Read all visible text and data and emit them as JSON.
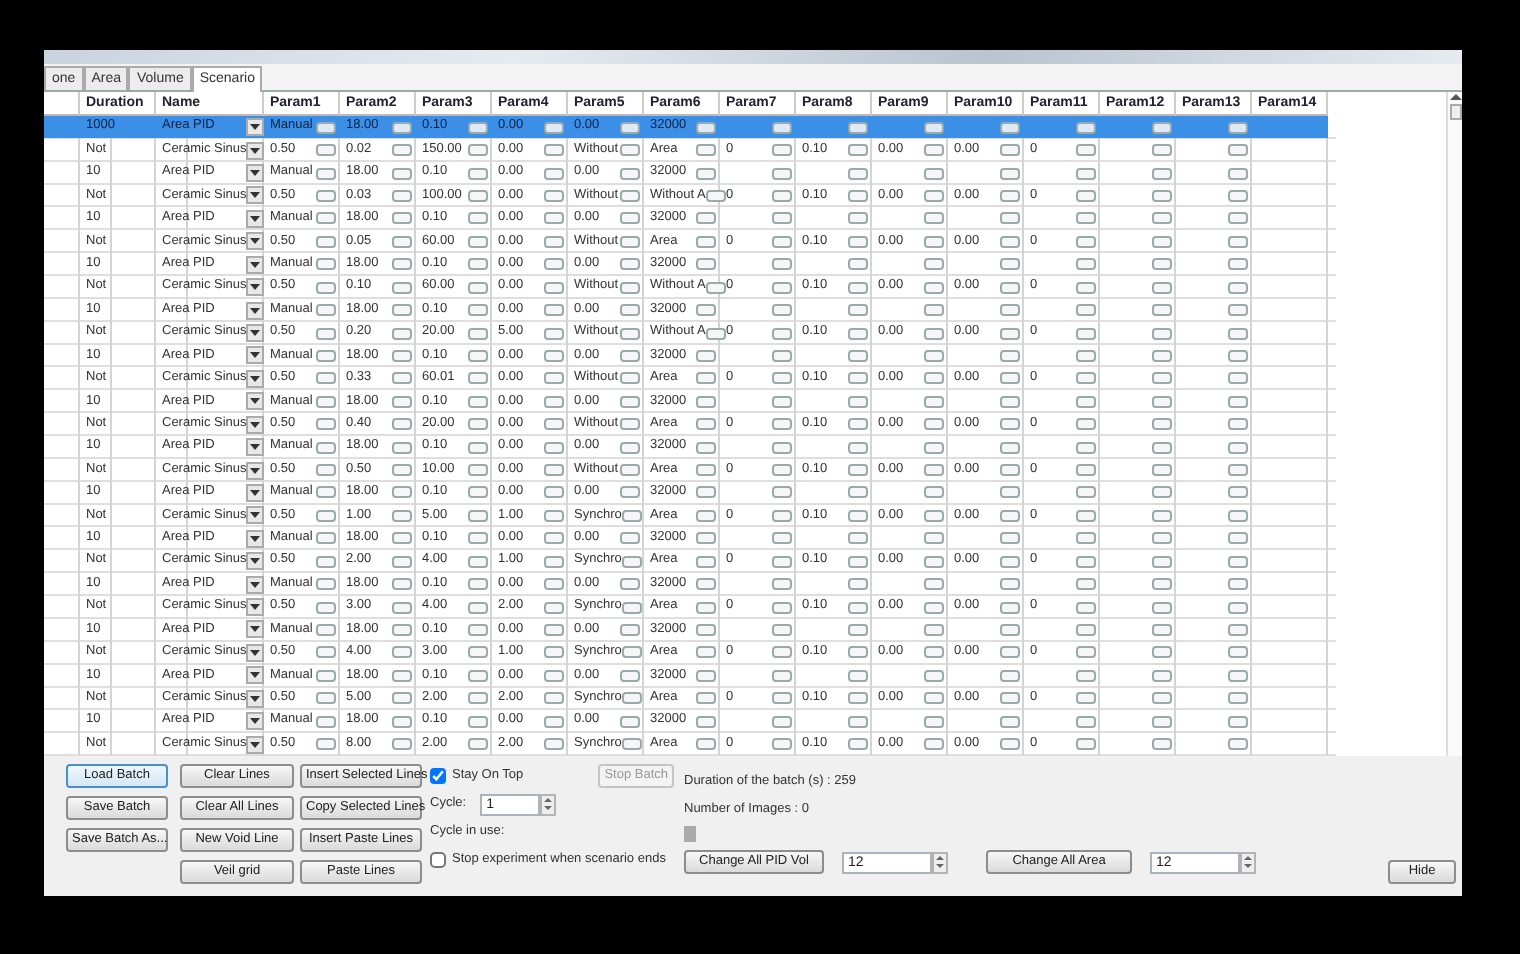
{
  "tabs": [
    {
      "label": "one",
      "selected": false
    },
    {
      "label": "Area",
      "selected": false
    },
    {
      "label": "Volume",
      "selected": false
    },
    {
      "label": "Scenario",
      "selected": true
    }
  ],
  "table": {
    "columns": [
      "Duration",
      "Name",
      "Param1",
      "Param2",
      "Param3",
      "Param4",
      "Param5",
      "Param6",
      "Param7",
      "Param8",
      "Param9",
      "Param10",
      "Param11",
      "Param12",
      "Param13",
      "Param14"
    ],
    "rows": [
      {
        "selected": true,
        "duration": "1000",
        "name": "Area PID",
        "params": [
          "Manual",
          "18.00",
          "0.10",
          "0.00",
          "0.00",
          "32000"
        ]
      },
      {
        "selected": false,
        "duration": "Not",
        "name": "Ceramic Sinus",
        "params": [
          "0.50",
          "0.02",
          "150.00",
          "0.00",
          "Without",
          "Area",
          "0",
          "0.10",
          "0.00",
          "0.00",
          "0"
        ]
      },
      {
        "selected": false,
        "duration": "10",
        "name": "Area PID",
        "params": [
          "Manual",
          "18.00",
          "0.10",
          "0.00",
          "0.00",
          "32000"
        ]
      },
      {
        "selected": false,
        "duration": "Not",
        "name": "Ceramic Sinus",
        "params": [
          "0.50",
          "0.03",
          "100.00",
          "0.00",
          "Without",
          "Without A",
          "0",
          "0.10",
          "0.00",
          "0.00",
          "0"
        ]
      },
      {
        "selected": false,
        "duration": "10",
        "name": "Area PID",
        "params": [
          "Manual",
          "18.00",
          "0.10",
          "0.00",
          "0.00",
          "32000"
        ]
      },
      {
        "selected": false,
        "duration": "Not",
        "name": "Ceramic Sinus",
        "params": [
          "0.50",
          "0.05",
          "60.00",
          "0.00",
          "Without",
          "Area",
          "0",
          "0.10",
          "0.00",
          "0.00",
          "0"
        ]
      },
      {
        "selected": false,
        "duration": "10",
        "name": "Area PID",
        "params": [
          "Manual",
          "18.00",
          "0.10",
          "0.00",
          "0.00",
          "32000"
        ]
      },
      {
        "selected": false,
        "duration": "Not",
        "name": "Ceramic Sinus",
        "params": [
          "0.50",
          "0.10",
          "60.00",
          "0.00",
          "Without",
          "Without A",
          "0",
          "0.10",
          "0.00",
          "0.00",
          "0"
        ]
      },
      {
        "selected": false,
        "duration": "10",
        "name": "Area PID",
        "params": [
          "Manual",
          "18.00",
          "0.10",
          "0.00",
          "0.00",
          "32000"
        ]
      },
      {
        "selected": false,
        "duration": "Not",
        "name": "Ceramic Sinus",
        "params": [
          "0.50",
          "0.20",
          "20.00",
          "5.00",
          "Without",
          "Without A",
          "0",
          "0.10",
          "0.00",
          "0.00",
          "0"
        ]
      },
      {
        "selected": false,
        "duration": "10",
        "name": "Area PID",
        "params": [
          "Manual",
          "18.00",
          "0.10",
          "0.00",
          "0.00",
          "32000"
        ]
      },
      {
        "selected": false,
        "duration": "Not",
        "name": "Ceramic Sinus",
        "params": [
          "0.50",
          "0.33",
          "60.01",
          "0.00",
          "Without",
          "Area",
          "0",
          "0.10",
          "0.00",
          "0.00",
          "0"
        ]
      },
      {
        "selected": false,
        "duration": "10",
        "name": "Area PID",
        "params": [
          "Manual",
          "18.00",
          "0.10",
          "0.00",
          "0.00",
          "32000"
        ]
      },
      {
        "selected": false,
        "duration": "Not",
        "name": "Ceramic Sinus",
        "params": [
          "0.50",
          "0.40",
          "20.00",
          "0.00",
          "Without",
          "Area",
          "0",
          "0.10",
          "0.00",
          "0.00",
          "0"
        ]
      },
      {
        "selected": false,
        "duration": "10",
        "name": "Area PID",
        "params": [
          "Manual",
          "18.00",
          "0.10",
          "0.00",
          "0.00",
          "32000"
        ]
      },
      {
        "selected": false,
        "duration": "Not",
        "name": "Ceramic Sinus",
        "params": [
          "0.50",
          "0.50",
          "10.00",
          "0.00",
          "Without",
          "Area",
          "0",
          "0.10",
          "0.00",
          "0.00",
          "0"
        ]
      },
      {
        "selected": false,
        "duration": "10",
        "name": "Area PID",
        "params": [
          "Manual",
          "18.00",
          "0.10",
          "0.00",
          "0.00",
          "32000"
        ]
      },
      {
        "selected": false,
        "duration": "Not",
        "name": "Ceramic Sinus",
        "params": [
          "0.50",
          "1.00",
          "5.00",
          "1.00",
          "Synchro",
          "Area",
          "0",
          "0.10",
          "0.00",
          "0.00",
          "0"
        ]
      },
      {
        "selected": false,
        "duration": "10",
        "name": "Area PID",
        "params": [
          "Manual",
          "18.00",
          "0.10",
          "0.00",
          "0.00",
          "32000"
        ]
      },
      {
        "selected": false,
        "duration": "Not",
        "name": "Ceramic Sinus",
        "params": [
          "0.50",
          "2.00",
          "4.00",
          "1.00",
          "Synchro",
          "Area",
          "0",
          "0.10",
          "0.00",
          "0.00",
          "0"
        ]
      },
      {
        "selected": false,
        "duration": "10",
        "name": "Area PID",
        "params": [
          "Manual",
          "18.00",
          "0.10",
          "0.00",
          "0.00",
          "32000"
        ]
      },
      {
        "selected": false,
        "duration": "Not",
        "name": "Ceramic Sinus",
        "params": [
          "0.50",
          "3.00",
          "4.00",
          "2.00",
          "Synchro",
          "Area",
          "0",
          "0.10",
          "0.00",
          "0.00",
          "0"
        ]
      },
      {
        "selected": false,
        "duration": "10",
        "name": "Area PID",
        "params": [
          "Manual",
          "18.00",
          "0.10",
          "0.00",
          "0.00",
          "32000"
        ]
      },
      {
        "selected": false,
        "duration": "Not",
        "name": "Ceramic Sinus",
        "params": [
          "0.50",
          "4.00",
          "3.00",
          "1.00",
          "Synchro",
          "Area",
          "0",
          "0.10",
          "0.00",
          "0.00",
          "0"
        ]
      },
      {
        "selected": false,
        "duration": "10",
        "name": "Area PID",
        "params": [
          "Manual",
          "18.00",
          "0.10",
          "0.00",
          "0.00",
          "32000"
        ]
      },
      {
        "selected": false,
        "duration": "Not",
        "name": "Ceramic Sinus",
        "params": [
          "0.50",
          "5.00",
          "2.00",
          "2.00",
          "Synchro",
          "Area",
          "0",
          "0.10",
          "0.00",
          "0.00",
          "0"
        ]
      },
      {
        "selected": false,
        "duration": "10",
        "name": "Area PID",
        "params": [
          "Manual",
          "18.00",
          "0.10",
          "0.00",
          "0.00",
          "32000"
        ]
      },
      {
        "selected": false,
        "duration": "Not",
        "name": "Ceramic Sinus",
        "params": [
          "0.50",
          "8.00",
          "2.00",
          "2.00",
          "Synchro",
          "Area",
          "0",
          "0.10",
          "0.00",
          "0.00",
          "0"
        ]
      }
    ]
  },
  "batch_panel": {
    "button_columns": [
      [
        "Load Batch",
        "Save Batch",
        "Save Batch As..."
      ],
      [
        "Clear Lines",
        "Clear All Lines",
        "New Void Line",
        "Veil grid"
      ],
      [
        "Insert Selected Lines",
        "Copy Selected Lines",
        "Insert Paste Lines",
        "Paste Lines"
      ]
    ],
    "stay_on_top": {
      "label": "Stay On Top",
      "checked": true
    },
    "stop_batch": {
      "label": "Stop Batch",
      "disabled": true
    },
    "cycle": {
      "label": "Cycle:",
      "value": "1"
    },
    "cycle_in_use": "Cycle in use:",
    "stop_experiment": {
      "label": "Stop experiment when scenario ends",
      "checked": false
    },
    "duration_text": "Duration of the batch (s) : 259",
    "images_text": "Number of Images : 0",
    "change_pid": {
      "label": "Change All PID Vol",
      "value": "12"
    },
    "change_area": {
      "label": "Change All Area",
      "value": "12"
    },
    "hide": "Hide"
  }
}
